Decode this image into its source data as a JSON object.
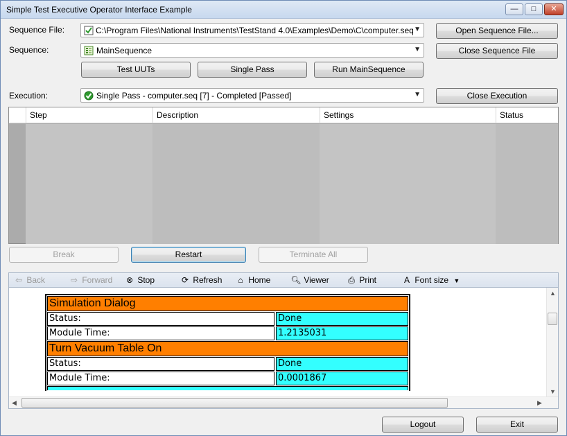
{
  "window": {
    "title": "Simple Test Executive Operator Interface Example",
    "minimize": "—",
    "maximize": "□",
    "close": "✕"
  },
  "sequence_file": {
    "label": "Sequence File:",
    "value": "C:\\Program Files\\National Instruments\\TestStand 4.0\\Examples\\Demo\\C\\computer.seq",
    "open_button": "Open Sequence File...",
    "close_button": "Close Sequence File"
  },
  "sequence": {
    "label": "Sequence:",
    "value": "MainSequence"
  },
  "run_buttons": {
    "test_uuts": "Test UUTs",
    "single_pass": "Single Pass",
    "run_main": "Run MainSequence"
  },
  "execution": {
    "label": "Execution:",
    "value": "Single Pass - computer.seq [7] - Completed [Passed]",
    "close_button": "Close Execution"
  },
  "steps_grid": {
    "columns": [
      "Step",
      "Description",
      "Settings",
      "Status"
    ]
  },
  "exec_buttons": {
    "break": "Break",
    "restart": "Restart",
    "terminate_all": "Terminate All"
  },
  "browser_toolbar": {
    "back": "Back",
    "forward": "Forward",
    "stop": "Stop",
    "refresh": "Refresh",
    "home": "Home",
    "viewer": "Viewer",
    "print": "Print",
    "font_size": "Font size"
  },
  "report": {
    "sections": [
      {
        "title": "Simulation Dialog",
        "status_label": "Status:",
        "status": "Done",
        "time_label": "Module Time:",
        "time": "1.2135031"
      },
      {
        "title": "Turn Vacuum Table On",
        "status_label": "Status:",
        "status": "Done",
        "time_label": "Module Time:",
        "time": "0.0001867"
      }
    ]
  },
  "footer": {
    "logout": "Logout",
    "exit": "Exit"
  },
  "colors": {
    "section_header": "#ff7f00",
    "value_cell": "#33ffff",
    "passed_icon": "#2e9a2e"
  }
}
